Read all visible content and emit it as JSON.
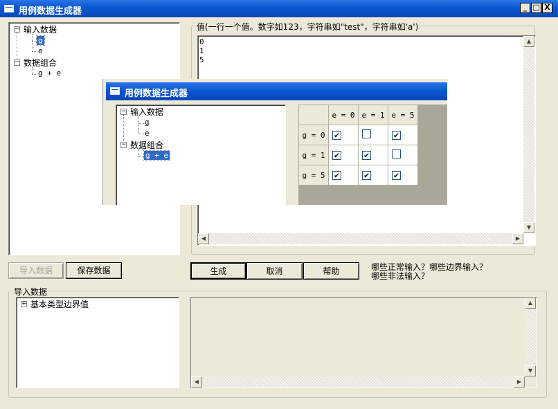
{
  "window": {
    "title": "用例数据生成器",
    "minimize": "_",
    "maximize": "□",
    "close": "X"
  },
  "left_tree": {
    "inputs_label": "输入数据",
    "var_g": "g",
    "var_e": "e",
    "combo_label": "数据组合",
    "combo_item": "g + e"
  },
  "values_group": {
    "label": "值(一行一个值。数字如123，字符串如\"test\"，字符串如'a')",
    "lines": [
      "0",
      "1",
      "5"
    ]
  },
  "buttons": {
    "import": "导入数据",
    "save": "保存数据",
    "generate": "生成",
    "cancel": "取消",
    "help": "帮助"
  },
  "hint": {
    "line1": "哪些正常输入？哪些边界输入？",
    "line2": "哪些非法输入？"
  },
  "import_group": {
    "label": "导入数据",
    "tree_item": "基本类型边界值"
  },
  "embedded": {
    "title": "用例数据生成器",
    "tree": {
      "inputs_label": "输入数据",
      "var_g": "g",
      "var_e": "e",
      "combo_label": "数据组合",
      "combo_item": "g + e"
    },
    "grid": {
      "col_headers": [
        "e = 0",
        "e = 1",
        "e = 5"
      ],
      "row_headers": [
        "g = 0",
        "g = 1",
        "g = 5"
      ],
      "checked": [
        [
          true,
          false,
          true
        ],
        [
          true,
          true,
          false
        ],
        [
          true,
          true,
          true
        ]
      ]
    }
  },
  "colors": {
    "titlebar": "#0b57d0",
    "face": "#ece9d8",
    "selection": "#316ac5"
  }
}
